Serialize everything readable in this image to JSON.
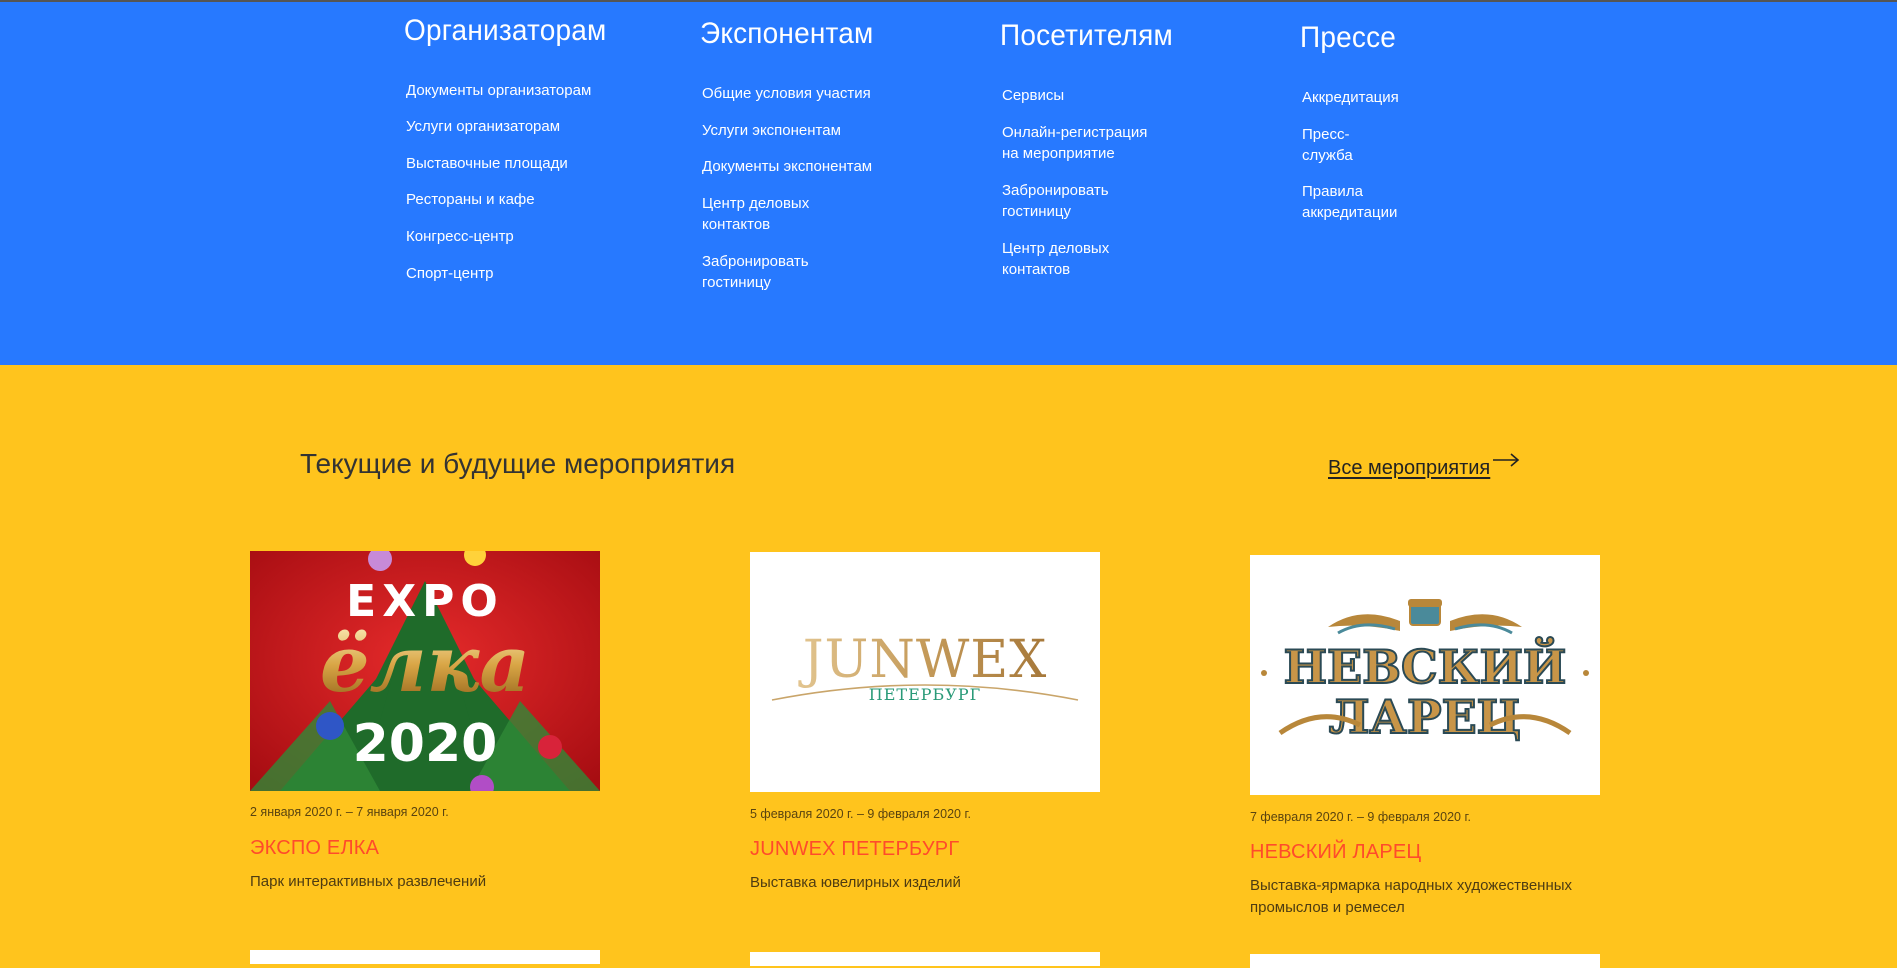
{
  "footer_nav": {
    "columns": [
      {
        "title": "Организаторам",
        "items": [
          "Документы организаторам",
          "Услуги организаторам",
          "Выставочные площади",
          "Рестораны и кафе",
          "Конгресс-центр",
          "Спорт-центр"
        ]
      },
      {
        "title": "Экспонентам",
        "items": [
          "Общие условия участия",
          "Услуги экспонентам",
          "Документы экспонентам",
          "Центр деловых контактов",
          "Забронировать гостиницу"
        ]
      },
      {
        "title": "Посетителям",
        "items": [
          "Сервисы",
          "Онлайн-регистрация",
          "на мероприятие",
          "Забронировать гостиницу",
          "Центр деловых контактов"
        ]
      },
      {
        "title": "Прессе",
        "items": [
          "Аккредитация",
          "Пресс-служба",
          "Правила аккредитации"
        ]
      }
    ]
  },
  "events": {
    "title": "Текущие и будущие мероприятия",
    "all_link": "Все мероприятия",
    "cards": [
      {
        "image_text": [
          "EXPO",
          "ёлка",
          "2020"
        ],
        "date": "2 января 2020 г. – 7 января 2020 г.",
        "title": "ЭКСПО ЕЛКА",
        "description": "Парк интерактивных развлечений"
      },
      {
        "image_text": [
          "JUNWEX",
          "ПЕТЕРБУРГ"
        ],
        "date": "5 февраля 2020 г. – 9 февраля 2020 г.",
        "title": "JUNWEX ПЕТЕРБУРГ",
        "description": "Выставка ювелирных изделий"
      },
      {
        "image_text": [
          "НЕВСКИЙ",
          "ЛАРЕЦ"
        ],
        "date": "7 февраля 2020 г. – 9 февраля 2020 г.",
        "title": "НЕВСКИЙ ЛАРЕЦ",
        "description": "Выставка-ярмарка народных художественных промыслов и ремесел"
      }
    ]
  },
  "colors": {
    "nav_bg": "#2779ff",
    "section_bg": "#ffc41d",
    "event_title": "#ff4b2b"
  }
}
